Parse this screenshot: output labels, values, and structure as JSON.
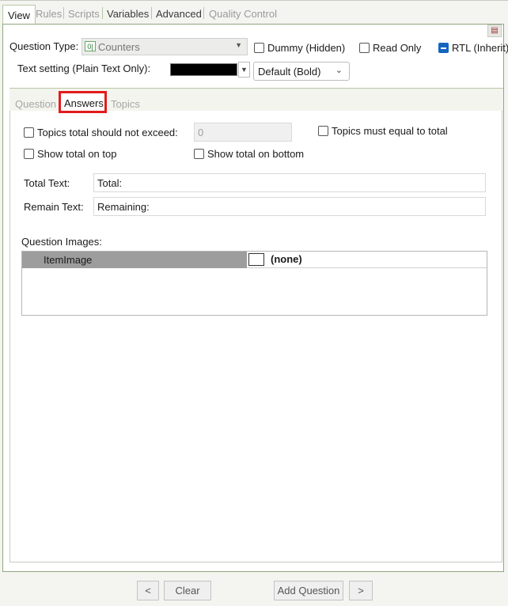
{
  "top_tabs": {
    "view": "View",
    "rules": "Rules",
    "scripts": "Scripts",
    "variables": "Variables",
    "advanced": "Advanced",
    "quality_control": "Quality Control"
  },
  "question_type": {
    "label": "Question Type:",
    "icon": "0|",
    "value": "Counters"
  },
  "checkboxes": {
    "dummy": "Dummy (Hidden)",
    "read_only": "Read Only",
    "rtl": "RTL (Inherit)"
  },
  "text_setting": {
    "label": "Text setting (Plain Text Only):",
    "color": "#000000",
    "style_value": "Default (Bold)"
  },
  "inner_tabs": {
    "question": "Question",
    "answers": "Answers",
    "topics": "Topics"
  },
  "answers": {
    "topics_total_label": "Topics total should not exceed:",
    "topics_total_value": "0",
    "topics_equal_label": "Topics must equal to total",
    "show_top_label": "Show total on top",
    "show_bottom_label": "Show total on bottom",
    "total_text_label": "Total Text:",
    "total_text_value": "Total:",
    "remain_text_label": "Remain Text:",
    "remain_text_value": "Remaining:"
  },
  "images": {
    "label": "Question Images:",
    "row_name": "ItemImage",
    "row_value": "(none)"
  },
  "buttons": {
    "prev": "<",
    "clear": "Clear",
    "add_question": "Add Question",
    "next": ">"
  }
}
